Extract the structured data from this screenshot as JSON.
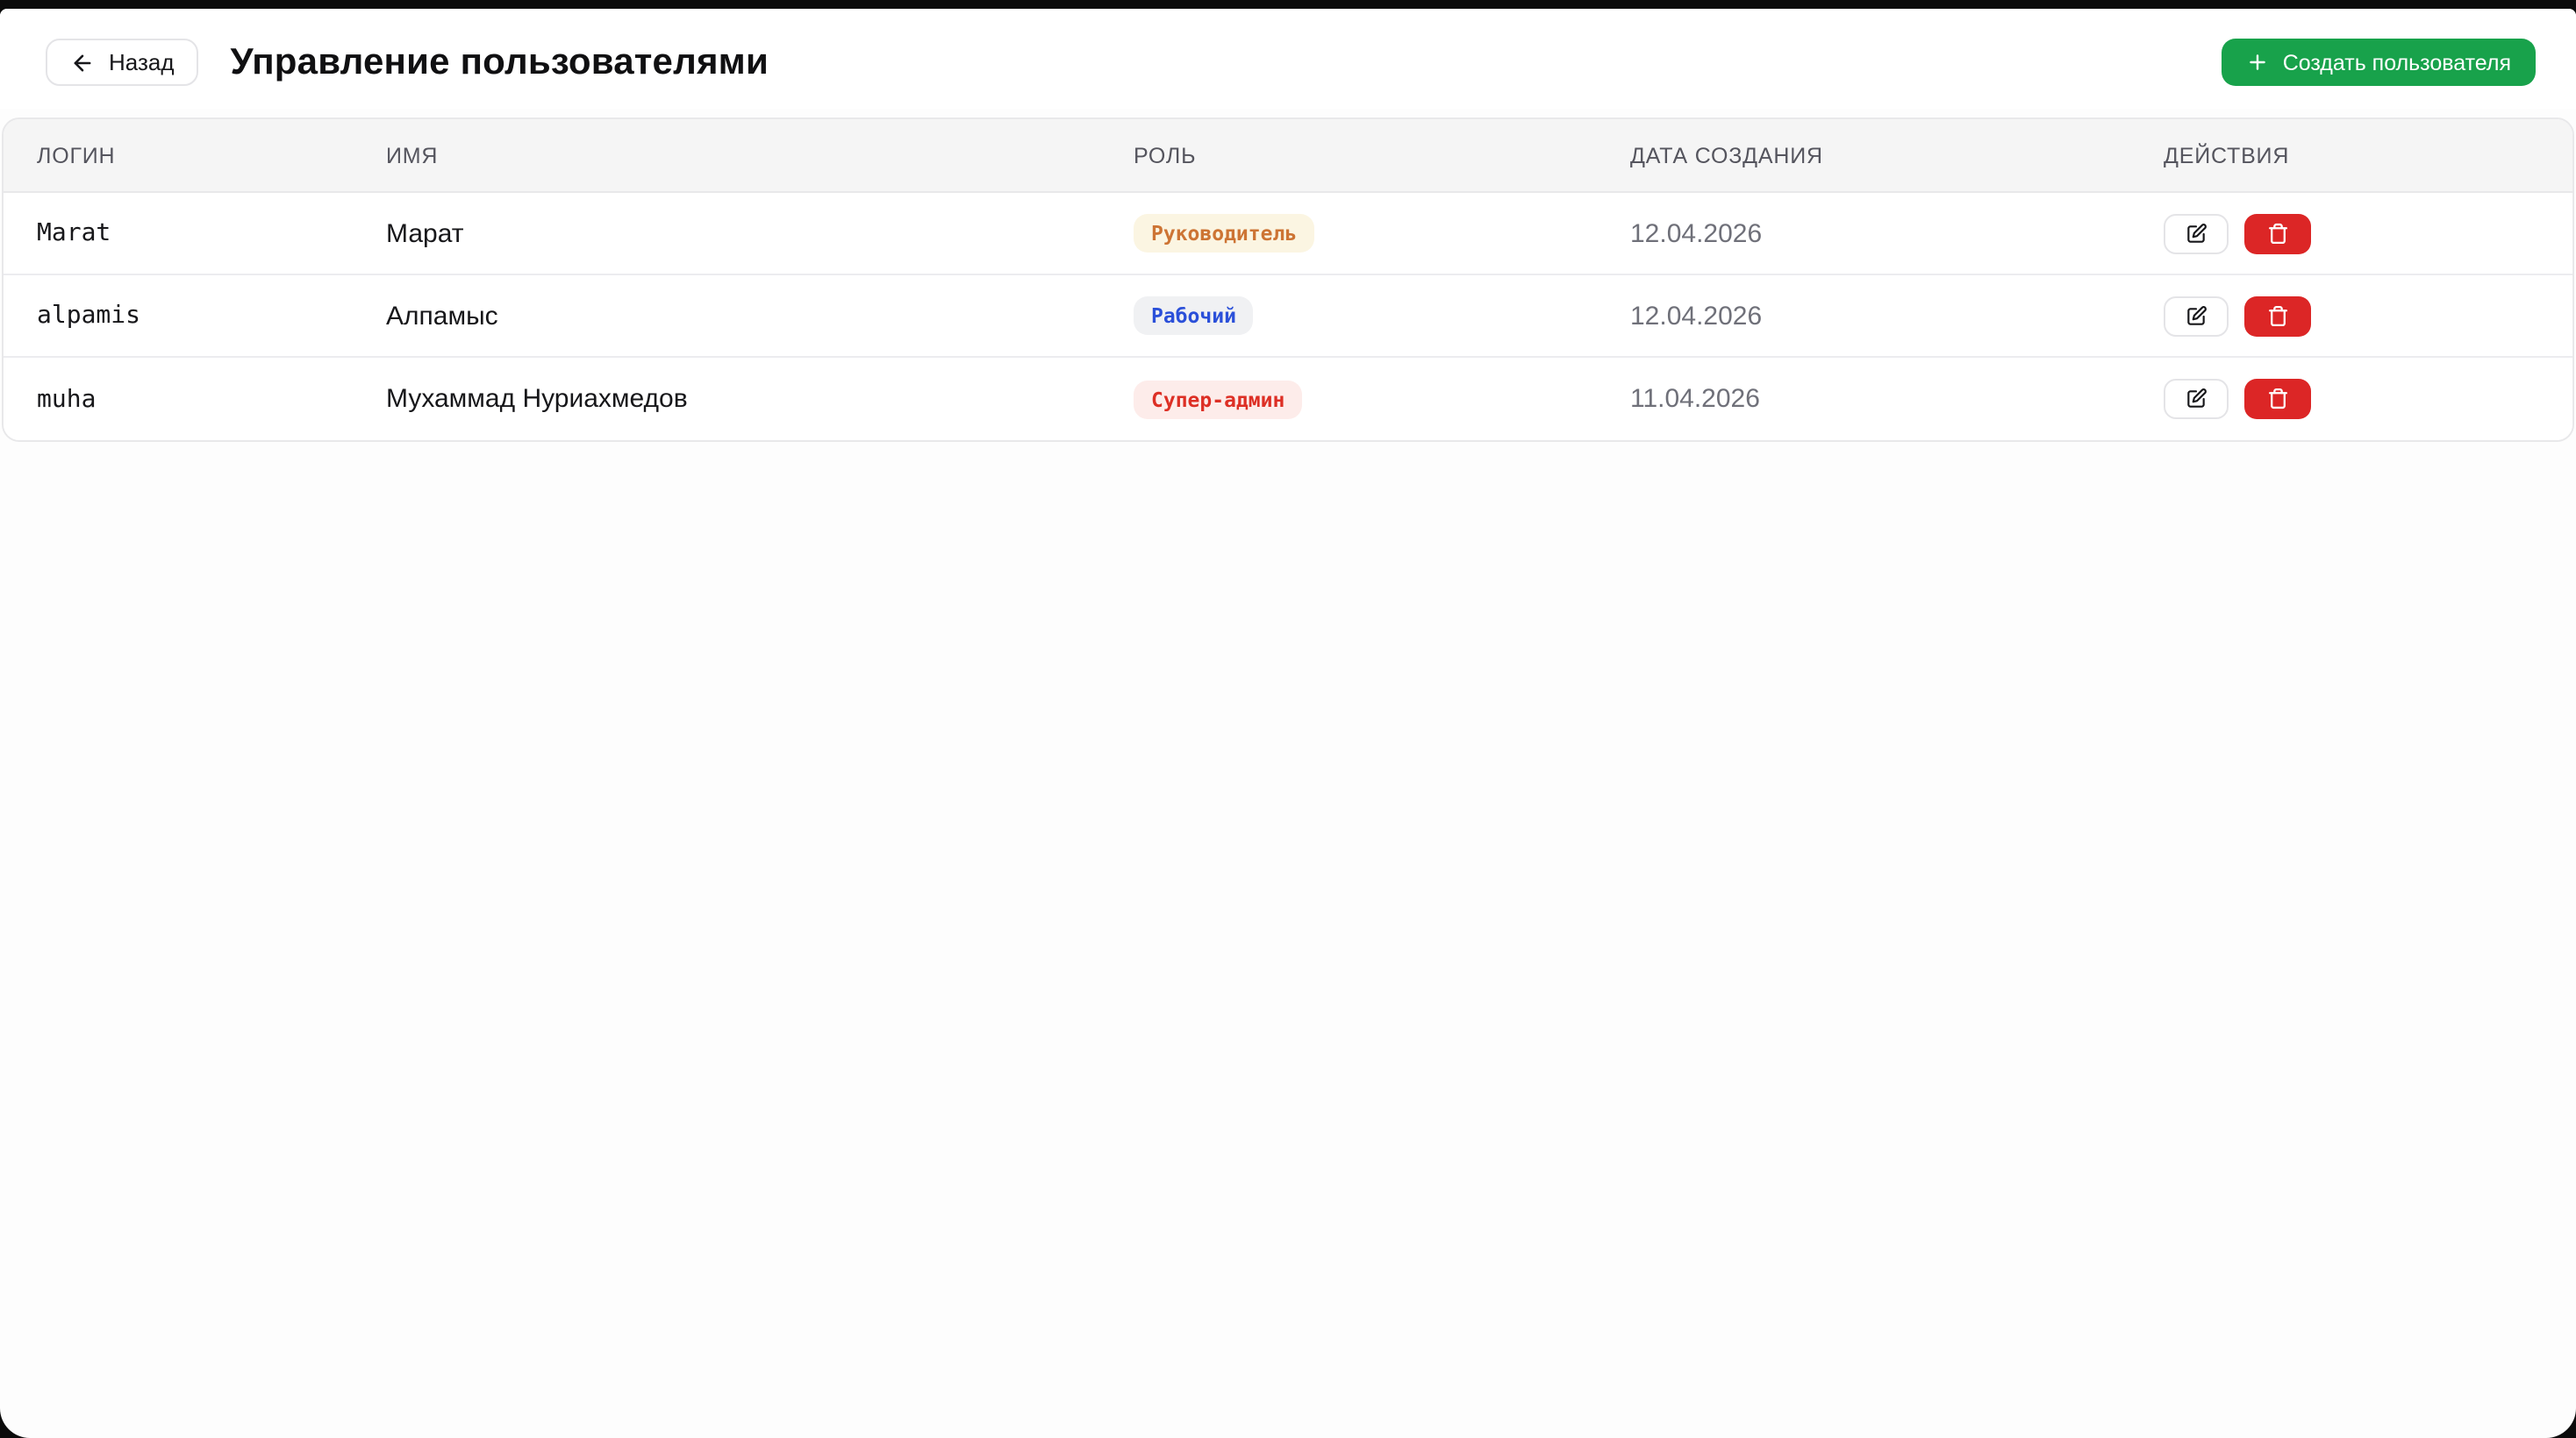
{
  "page": {
    "title": "Управление пользователями",
    "back_label": "Назад",
    "create_button_label": "Создать пользователя"
  },
  "table": {
    "columns": [
      "ЛОГИН",
      "ИМЯ",
      "РОЛЬ",
      "ДАТА СОЗДАНИЯ",
      "ДЕЙСТВИЯ"
    ],
    "rows": [
      {
        "login": "Marat",
        "name": "Марат",
        "role": "Руководитель",
        "role_type": "manager",
        "created": "12.04.2026"
      },
      {
        "login": "alpamis",
        "name": "Алпамыс",
        "role": "Рабочий",
        "role_type": "worker",
        "created": "12.04.2026"
      },
      {
        "login": "muha",
        "name": "Мухаммад Нуриахмедов",
        "role": "Супер-админ",
        "role_type": "superadmin",
        "created": "11.04.2026"
      }
    ]
  },
  "icons": {
    "back": "arrow-left-icon",
    "create": "plus-icon",
    "edit": "edit-pencil-square-icon",
    "delete": "trash-icon"
  },
  "colors": {
    "accent_green": "#18a24b",
    "danger_red": "#dc2626",
    "badge_manager_bg": "#fbf5e2",
    "badge_manager_text": "#cd7434",
    "badge_worker_bg": "#f0f1f3",
    "badge_worker_text": "#2b50d9",
    "badge_superadmin_bg": "#fdecea",
    "badge_superadmin_text": "#dd2f25",
    "table_header_bg": "#f5f5f5",
    "window_frame": "#0b0b0b"
  }
}
